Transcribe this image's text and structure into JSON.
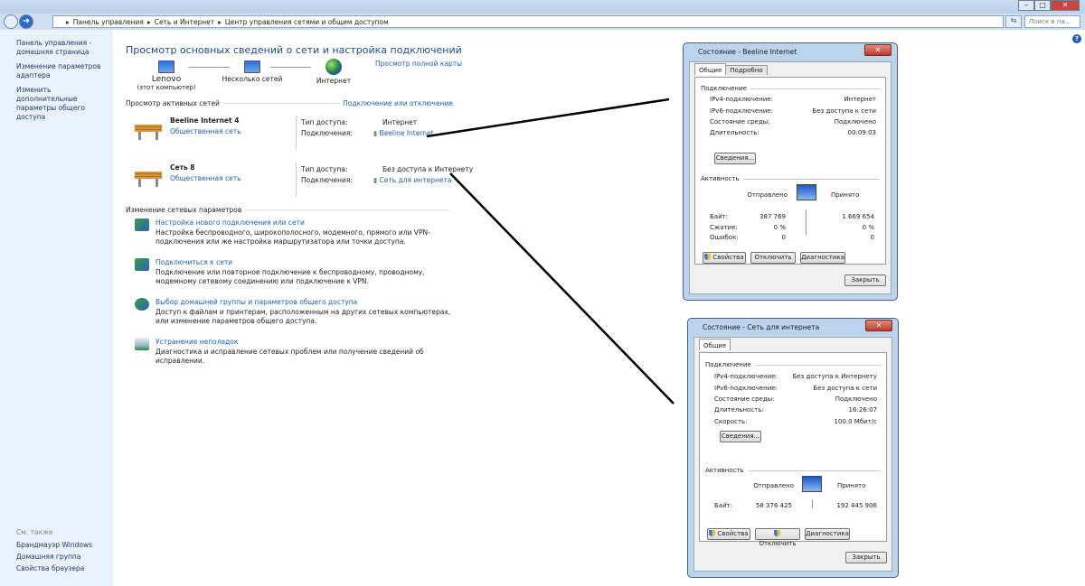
{
  "window": {
    "minimize": "–",
    "maximize": "□",
    "close": "✕"
  },
  "address": {
    "breadcrumb": [
      "Панель управления",
      "Сеть и Интернет",
      "Центр управления сетями и общим доступом"
    ],
    "search_placeholder": "Поиск в па..."
  },
  "sidebar": {
    "items": [
      "Панель управления - домашняя страница",
      "Изменение параметров адаптера",
      "Изменить дополнительные параметры общего доступа"
    ],
    "see_also": {
      "header": "См. также",
      "items": [
        "Брандмауэр Windows",
        "Домашняя группа",
        "Свойства браузера"
      ]
    }
  },
  "main": {
    "title": "Просмотр основных сведений о сети и настройка подключений",
    "map": {
      "computer": "Lenovo",
      "computer_sub": "(этот компьютер)",
      "networks": "Несколько сетей",
      "internet": "Интернет",
      "full_map_link": "Просмотр полной карты"
    },
    "active_header": "Просмотр активных сетей",
    "connect_link": "Подключение или отключение",
    "access_label": "Тип доступа:",
    "connections_label": "Подключения:",
    "networks": [
      {
        "name": "Beeline Internet  4",
        "type": "Общественная сеть",
        "access": "Интернет",
        "connection": "Beeline Internet"
      },
      {
        "name": "Сеть  8",
        "type": "Общественная сеть",
        "access": "Без доступа к Интернету",
        "connection": "Сеть для интернета"
      }
    ],
    "change_header": "Изменение сетевых параметров",
    "tasks": [
      {
        "title": "Настройка нового подключения или сети",
        "desc": "Настройка беспроводного, широкополосного, модемного, прямого или VPN-подключения или же настройка маршрутизатора или точки доступа."
      },
      {
        "title": "Подключиться к сети",
        "desc": "Подключение или повторное подключение к беспроводному, проводному, модемному сетевому соединению или подключение к VPN."
      },
      {
        "title": "Выбор домашней группы и параметров общего доступа",
        "desc": "Доступ к файлам и принтерам, расположенным на других сетевых компьютерах, или изменение параметров общего доступа."
      },
      {
        "title": "Устранение неполадок",
        "desc": "Диагностика и исправление сетевых проблем или получение сведений об исправлении."
      }
    ]
  },
  "dialog1": {
    "title": "Состояние - Beeline Internet",
    "tabs": [
      "Общие",
      "Подробно"
    ],
    "connection_header": "Подключение",
    "rows": [
      [
        "IPv4-подключение:",
        "Интернет"
      ],
      [
        "IPv6-подключение:",
        "Без доступа к сети"
      ],
      [
        "Состояние среды:",
        "Подключено"
      ],
      [
        "Длительность:",
        "00:09:03"
      ]
    ],
    "details_btn": "Сведения...",
    "activity_header": "Активность",
    "sent": "Отправлено",
    "received": "Принято",
    "stats": [
      [
        "Байт:",
        "387 769",
        "1 669 654"
      ],
      [
        "Сжатие:",
        "0 %",
        "0 %"
      ],
      [
        "Ошибок:",
        "0",
        "0"
      ]
    ],
    "buttons": [
      "Свойства",
      "Отключить",
      "Диагностика"
    ],
    "close": "Закрыть"
  },
  "dialog2": {
    "title": "Состояние - Сеть для интернета",
    "tabs": [
      "Общие"
    ],
    "connection_header": "Подключение",
    "rows": [
      [
        "IPv4-подключение:",
        "Без доступа к Интернету"
      ],
      [
        "IPv6-подключение:",
        "Без доступа к сети"
      ],
      [
        "Состояние среды:",
        "Подключено"
      ],
      [
        "Длительность:",
        "16:26:07"
      ],
      [
        "Скорость:",
        "100.0 Мбит/с"
      ]
    ],
    "details_btn": "Сведения...",
    "activity_header": "Активность",
    "sent": "Отправлено",
    "received": "Принято",
    "stats": [
      [
        "Байт:",
        "58 376 425",
        "192 445 906"
      ]
    ],
    "buttons": [
      "Свойства",
      "Отключить",
      "Диагностика"
    ],
    "close": "Закрыть"
  }
}
